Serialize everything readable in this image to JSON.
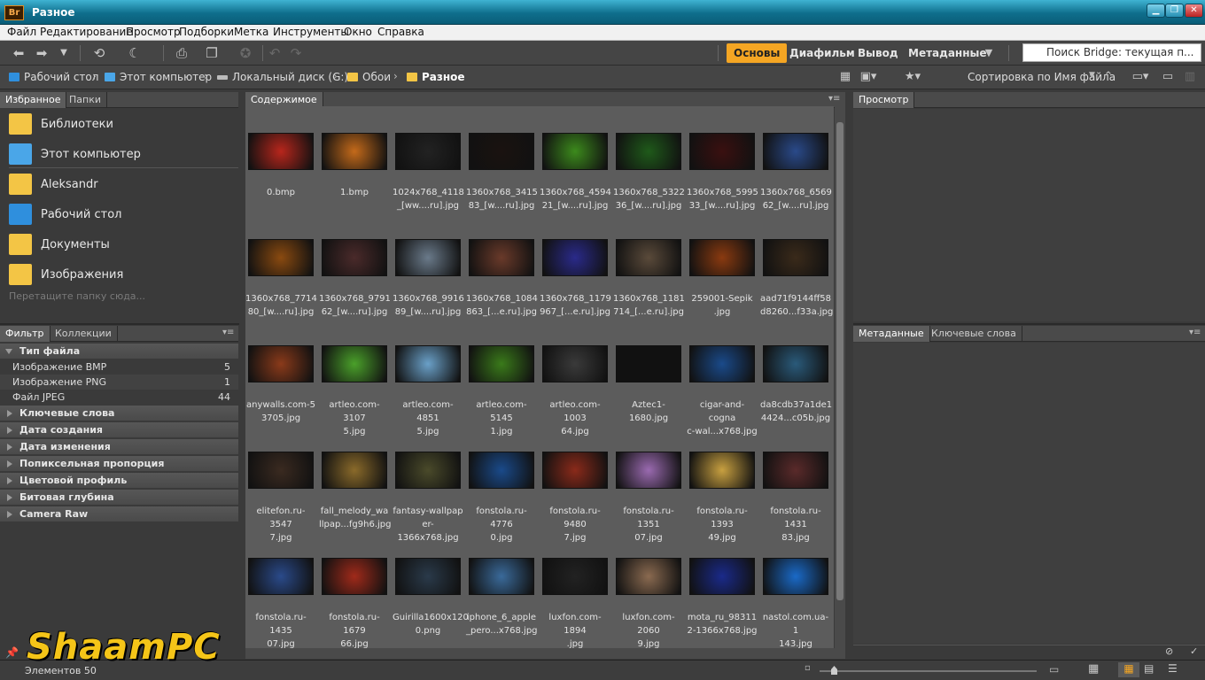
{
  "window": {
    "title": "Разное",
    "app_badge": "Br",
    "minimize": "▁",
    "maximize": "❐",
    "close": "✕"
  },
  "menu": [
    "Файл",
    "Редактирование",
    "Просмотр",
    "Подборки",
    "Метка",
    "Инструменты",
    "Окно",
    "Справка"
  ],
  "workspaces": {
    "active": "Основы",
    "items": [
      "Диафильм",
      "Вывод",
      "Метаданные"
    ]
  },
  "search": {
    "placeholder": "Поиск Bridge: текущая п..."
  },
  "path": [
    "Рабочий стол",
    "Этот компьютер",
    "Локальный диск (G:)",
    "Обои",
    "Разное"
  ],
  "sort_label": "Сортировка по Имя файла",
  "left_tabs": [
    "Избранное",
    "Папки"
  ],
  "favorites": [
    {
      "label": "Библиотеки",
      "color": "#f3c545"
    },
    {
      "label": "Этот компьютер",
      "color": "#4aa6e8"
    },
    {
      "label": "Aleksandr",
      "color": "#f3c545"
    },
    {
      "label": "Рабочий стол",
      "color": "#2f8fdd"
    },
    {
      "label": "Документы",
      "color": "#f3c545"
    },
    {
      "label": "Изображения",
      "color": "#f3c545"
    }
  ],
  "favorites_hint": "Перетащите папку сюда...",
  "filter_tabs": [
    "Фильтр",
    "Коллекции"
  ],
  "filter": {
    "open_section": "Тип файла",
    "rows": [
      {
        "label": "Изображение BMP",
        "count": "5"
      },
      {
        "label": "Изображение PNG",
        "count": "1"
      },
      {
        "label": "Файл JPEG",
        "count": "44"
      }
    ],
    "sections": [
      "Ключевые слова",
      "Дата создания",
      "Дата изменения",
      "Попиксельная пропорция",
      "Цветовой профиль",
      "Битовая глубина",
      "Camera Raw"
    ]
  },
  "content_tab": "Содержимое",
  "preview_tab": "Просмотр",
  "meta_tabs": [
    "Метаданные",
    "Ключевые слова"
  ],
  "thumbs": [
    {
      "l1": "0.bmp",
      "l2": "",
      "c": "#b8261c"
    },
    {
      "l1": "1.bmp",
      "l2": "",
      "c": "#c46a1a"
    },
    {
      "l1": "1024x768_4118",
      "l2": "_[ww....ru].jpg",
      "c": "#222222"
    },
    {
      "l1": "1360x768_3415",
      "l2": "83_[w....ru].jpg",
      "c": "#1a1210"
    },
    {
      "l1": "1360x768_4594",
      "l2": "21_[w....ru].jpg",
      "c": "#3c8a1c"
    },
    {
      "l1": "1360x768_5322",
      "l2": "36_[w....ru].jpg",
      "c": "#1f5a1a"
    },
    {
      "l1": "1360x768_5995",
      "l2": "33_[w....ru].jpg",
      "c": "#3a1010"
    },
    {
      "l1": "1360x768_6569",
      "l2": "62_[w....ru].jpg",
      "c": "#2a4a8a"
    },
    {
      "l1": "1360x768_7714",
      "l2": "80_[w....ru].jpg",
      "c": "#8a4a10"
    },
    {
      "l1": "1360x768_9791",
      "l2": "62_[w....ru].jpg",
      "c": "#4a2a2a"
    },
    {
      "l1": "1360x768_9916",
      "l2": "89_[w....ru].jpg",
      "c": "#6a7a8a"
    },
    {
      "l1": "1360x768_1084",
      "l2": "863_[...e.ru].jpg",
      "c": "#6a3a2a"
    },
    {
      "l1": "1360x768_1179",
      "l2": "967_[...e.ru].jpg",
      "c": "#2a2a8a"
    },
    {
      "l1": "1360x768_1181",
      "l2": "714_[...e.ru].jpg",
      "c": "#5a4a3a"
    },
    {
      "l1": "259001-Sepik",
      "l2": ".jpg",
      "c": "#8a3a10"
    },
    {
      "l1": "aad71f9144ff58",
      "l2": "d8260...f33a.jpg",
      "c": "#3a2a1a"
    },
    {
      "l1": "anywalls.com-5",
      "l2": "3705.jpg",
      "c": "#8a3a1a"
    },
    {
      "l1": "artleo.com-3107",
      "l2": "5.jpg",
      "c": "#4aa02a"
    },
    {
      "l1": "artleo.com-4851",
      "l2": "5.jpg",
      "c": "#6aa0c8"
    },
    {
      "l1": "artleo.com-5145",
      "l2": "1.jpg",
      "c": "#3a7a1a"
    },
    {
      "l1": "artleo.com-1003",
      "l2": "64.jpg",
      "c": "#3a3a3a"
    },
    {
      "l1": "Aztec1-1680.jpg",
      "l2": "",
      "c": "#111111"
    },
    {
      "l1": "cigar-and-cogna",
      "l2": "c-wal...x768.jpg",
      "c": "#1a4a8a"
    },
    {
      "l1": "da8cdb37a1de1",
      "l2": "4424...c05b.jpg",
      "c": "#2a5a7a"
    },
    {
      "l1": "elitefon.ru-3547",
      "l2": "7.jpg",
      "c": "#3a2a20"
    },
    {
      "l1": "fall_melody_wa",
      "l2": "llpap...fg9h6.jpg",
      "c": "#8a6a2a"
    },
    {
      "l1": "fantasy-wallpap",
      "l2": "er-1366x768.jpg",
      "c": "#4a4a2a"
    },
    {
      "l1": "fonstola.ru-4776",
      "l2": "0.jpg",
      "c": "#1a4a8a"
    },
    {
      "l1": "fonstola.ru-9480",
      "l2": "7.jpg",
      "c": "#8a2a1a"
    },
    {
      "l1": "fonstola.ru-1351",
      "l2": "07.jpg",
      "c": "#9a6ab0"
    },
    {
      "l1": "fonstola.ru-1393",
      "l2": "49.jpg",
      "c": "#c8a040"
    },
    {
      "l1": "fonstola.ru-1431",
      "l2": "83.jpg",
      "c": "#5a2a2a"
    },
    {
      "l1": "fonstola.ru-1435",
      "l2": "07.jpg",
      "c": "#2a4a8a"
    },
    {
      "l1": "fonstola.ru-1679",
      "l2": "66.jpg",
      "c": "#a02a1a"
    },
    {
      "l1": "Guirilla1600x120",
      "l2": "0.png",
      "c": "#2a3a4a"
    },
    {
      "l1": "iphone_6_apple",
      "l2": "_pero...x768.jpg",
      "c": "#3a6a9a"
    },
    {
      "l1": "luxfon.com-1894",
      "l2": ".jpg",
      "c": "#222222"
    },
    {
      "l1": "luxfon.com-2060",
      "l2": "9.jpg",
      "c": "#8a6a50"
    },
    {
      "l1": "mota_ru_98311",
      "l2": "2-1366x768.jpg",
      "c": "#1a2a8a"
    },
    {
      "l1": "nastol.com.ua-1",
      "l2": "143.jpg",
      "c": "#1a6ac8"
    }
  ],
  "status": "Элементов 50",
  "watermark": "ShaamPC"
}
